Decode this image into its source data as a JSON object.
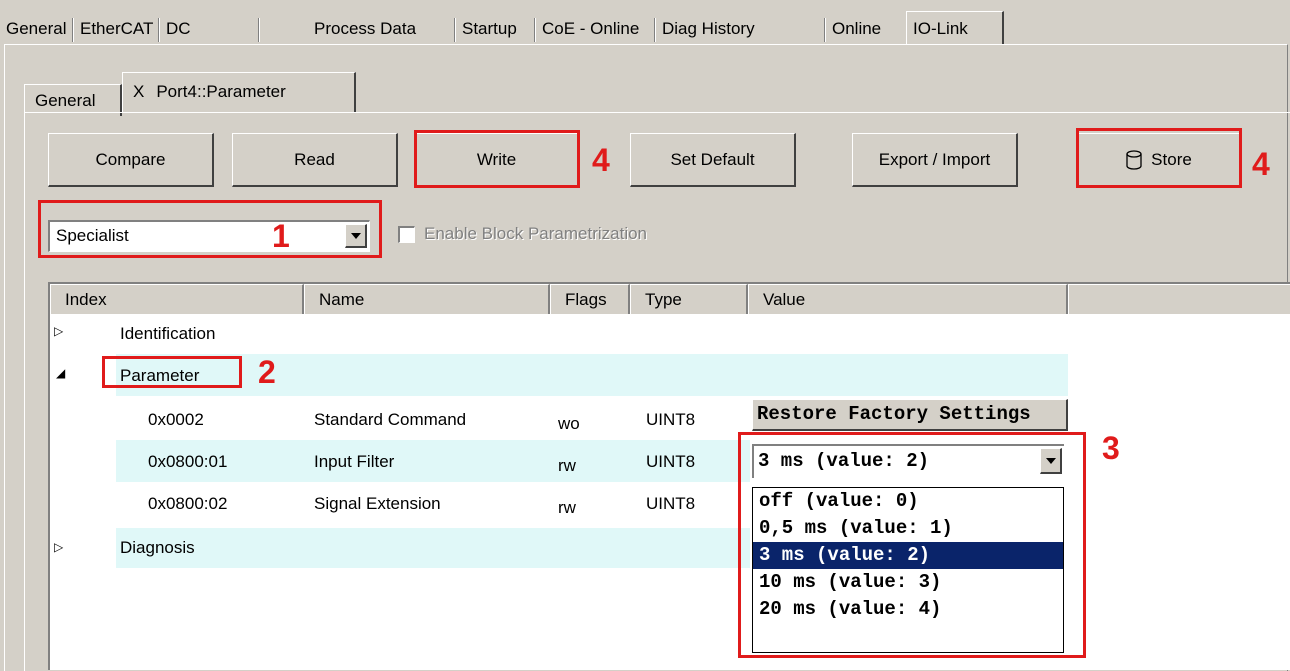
{
  "outer_tabs": [
    "General",
    "EtherCAT",
    "DC",
    "Process Data",
    "Startup",
    "CoE - Online",
    "Diag History",
    "Online",
    "IO-Link"
  ],
  "inner_tabs": {
    "general": "General",
    "close_glyph": "X",
    "port": "Port4::Parameter"
  },
  "toolbar": {
    "compare": "Compare",
    "read": "Read",
    "write": "Write",
    "set_default": "Set Default",
    "export_import": "Export / Import",
    "store": "Store"
  },
  "mode_select": {
    "value": "Specialist"
  },
  "block_param": {
    "label": "Enable Block Parametrization",
    "checked": false,
    "enabled": false
  },
  "columns": [
    "Index",
    "Name",
    "Flags",
    "Type",
    "Value"
  ],
  "tree": {
    "identification": "Identification",
    "parameter": "Parameter",
    "diagnosis": "Diagnosis"
  },
  "rows": [
    {
      "index": "0x0002",
      "name": "Standard Command",
      "flags": "wo",
      "type": "UINT8",
      "value": "Restore Factory Settings"
    },
    {
      "index": "0x0800:01",
      "name": "Input Filter",
      "flags": "rw",
      "type": "UINT8",
      "value": "3 ms (value: 2)"
    },
    {
      "index": "0x0800:02",
      "name": "Signal Extension",
      "flags": "rw",
      "type": "UINT8",
      "value": ""
    }
  ],
  "dropdown_options": [
    "off (value: 0)",
    "0,5 ms (value: 1)",
    "3 ms (value: 2)",
    "10 ms (value: 3)",
    "20 ms (value: 4)"
  ],
  "dropdown_selected_index": 2,
  "markers": {
    "m1": "1",
    "m2": "2",
    "m3": "3",
    "m4a": "4",
    "m4b": "4"
  },
  "colors": {
    "highlight": "#e01b1b",
    "selection": "#0a246a",
    "row_tint": "#e0f8f8"
  }
}
